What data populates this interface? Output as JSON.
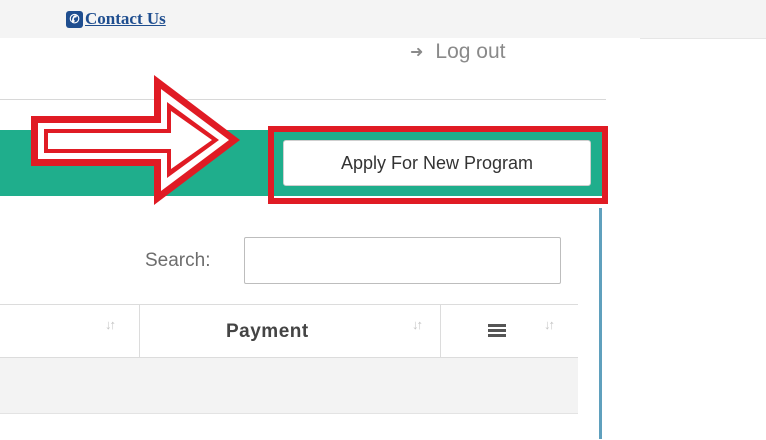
{
  "topbar": {
    "contact_label": "Contact Us",
    "contact_icon": "phone-icon"
  },
  "header": {
    "logout_label": "Log out",
    "logout_icon": "sign-out-icon"
  },
  "panel": {
    "apply_button_label": "Apply For New Program",
    "header_color": "#1fae8c",
    "highlight_color": "#e01b24"
  },
  "search": {
    "label": "Search:",
    "value": ""
  },
  "table": {
    "columns": [
      {
        "label": ""
      },
      {
        "label": "Payment"
      },
      {
        "label": "",
        "icon": "list-icon"
      }
    ],
    "rows": [
      []
    ]
  }
}
